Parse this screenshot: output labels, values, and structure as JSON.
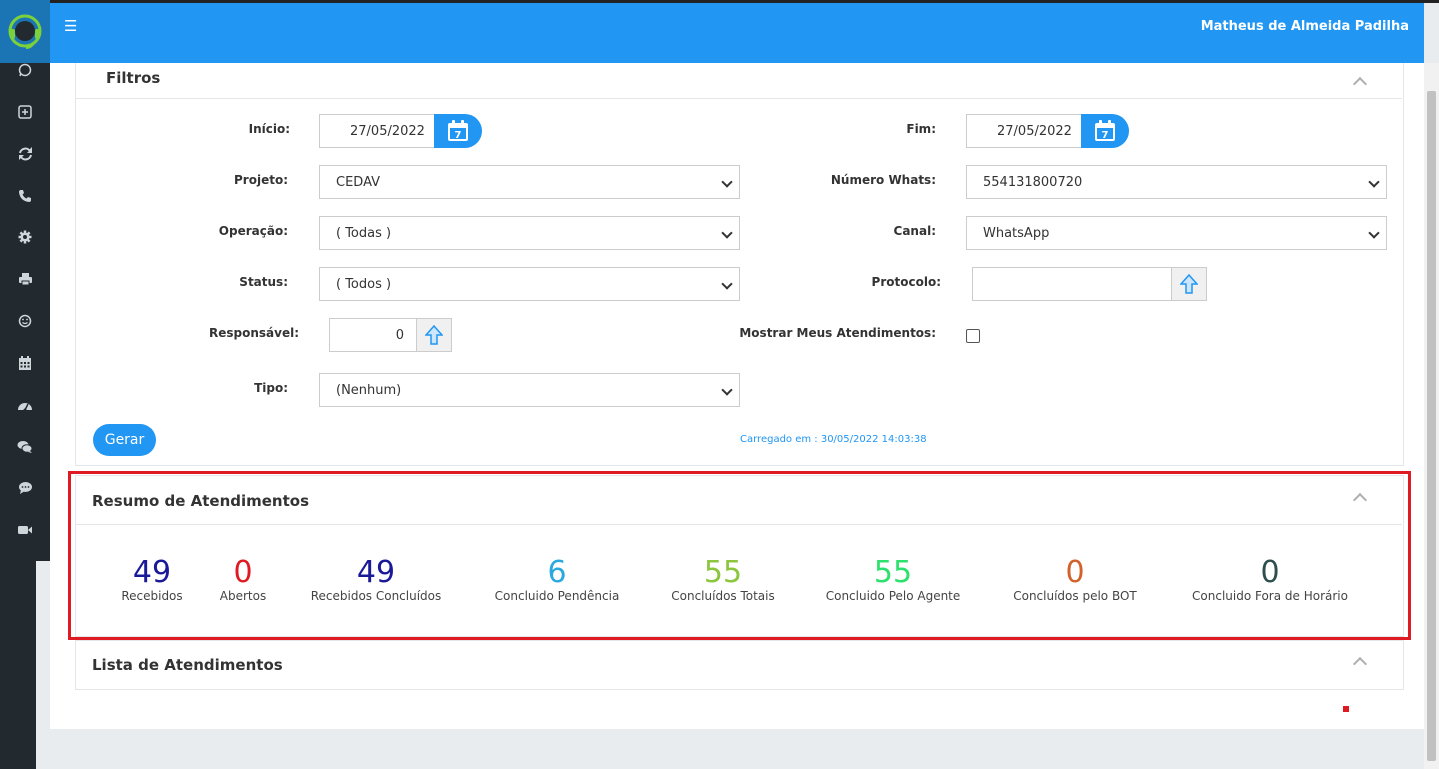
{
  "header": {
    "user_name": "Matheus de Almeida Padilha",
    "menu_icon": "☰"
  },
  "sidebar": {
    "items": [
      "whatsapp-icon",
      "plus-square-icon",
      "sync-icon",
      "phone-icon",
      "gear-icon",
      "print-icon",
      "smile-icon",
      "calendar-icon",
      "dashboard-icon",
      "comments-icon",
      "comment-icon",
      "video-icon"
    ]
  },
  "filters": {
    "title": "Filtros",
    "inicio": {
      "label": "Início:",
      "value": "27/05/2022"
    },
    "fim": {
      "label": "Fim:",
      "value": "27/05/2022"
    },
    "projeto": {
      "label": "Projeto:",
      "value": "CEDAV"
    },
    "numero_whats": {
      "label": "Número Whats:",
      "value": "554131800720"
    },
    "operacao": {
      "label": "Operação:",
      "value": "( Todas )"
    },
    "canal": {
      "label": "Canal:",
      "value": "WhatsApp"
    },
    "status": {
      "label": "Status:",
      "value": "( Todos )"
    },
    "protocolo": {
      "label": "Protocolo:",
      "value": ""
    },
    "responsavel": {
      "label": "Responsável:",
      "value": "0"
    },
    "mostrar": {
      "label": "Mostrar Meus Atendimentos:",
      "checked": false
    },
    "tipo": {
      "label": "Tipo:",
      "value": "(Nenhum)"
    },
    "calendar_day": "7",
    "gerar_label": "Gerar",
    "loaded_text": "Carregado em : 30/05/2022 14:03:38"
  },
  "summary": {
    "title": "Resumo de Atendimentos",
    "stats": [
      {
        "value": "49",
        "label": "Recebidos",
        "color": "#1a1a99"
      },
      {
        "value": "0",
        "label": "Abertos",
        "color": "#e01a22"
      },
      {
        "value": "49",
        "label": "Recebidos Concluídos",
        "color": "#1a1a99"
      },
      {
        "value": "6",
        "label": "Concluido Pendência",
        "color": "#2aa9e0"
      },
      {
        "value": "55",
        "label": "Concluídos Totais",
        "color": "#8cc63f"
      },
      {
        "value": "55",
        "label": "Concluido Pelo Agente",
        "color": "#2ee06e"
      },
      {
        "value": "0",
        "label": "Concluídos pelo BOT",
        "color": "#d2622b"
      },
      {
        "value": "0",
        "label": "Concluido Fora de Horário",
        "color": "#2f4f4f"
      }
    ]
  },
  "list": {
    "title": "Lista de Atendimentos"
  },
  "colors": {
    "accent": "#2196f3",
    "sidebar": "#232a2f",
    "highlight": "#e01a22"
  }
}
